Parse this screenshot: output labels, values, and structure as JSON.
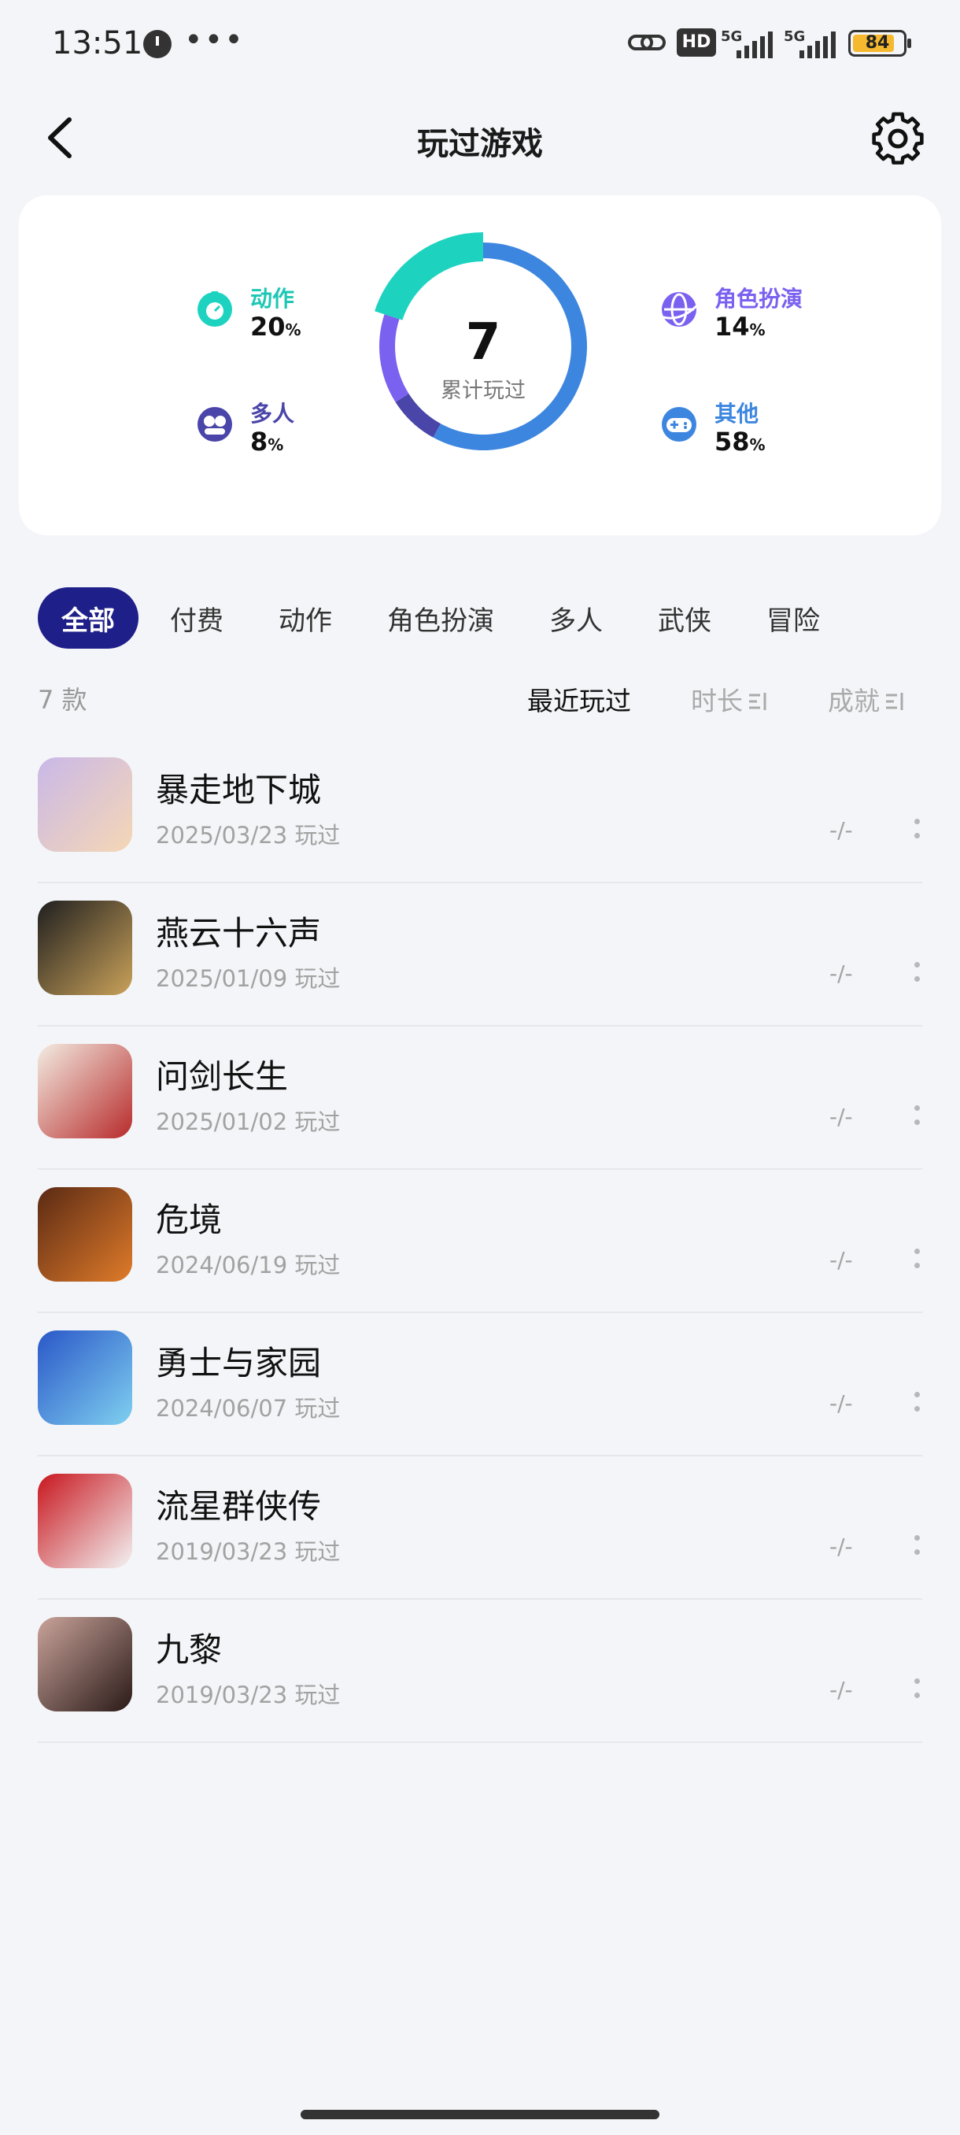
{
  "status_bar": {
    "time": "13:51",
    "dots": "•••",
    "hd_label": "HD",
    "network_1": "5G",
    "network_2": "5G",
    "battery": "84",
    "battery_level_percent": 84
  },
  "header": {
    "title": "玩过游戏",
    "back_icon": "chevron-left-icon",
    "settings_icon": "gear-icon"
  },
  "summary": {
    "total_count": "7",
    "total_caption": "累计玩过",
    "categories": [
      {
        "name": "动作",
        "percent": "20",
        "value": 20,
        "color": "#1dd3c0",
        "icon": "action-icon"
      },
      {
        "name": "多人",
        "percent": "8",
        "value": 8,
        "color": "#4a45a8",
        "icon": "multiplayer-icon"
      },
      {
        "name": "角色扮演",
        "percent": "14",
        "value": 14,
        "color": "#7b61f0",
        "icon": "globe-icon"
      },
      {
        "name": "其他",
        "percent": "58",
        "value": 58,
        "color": "#3d86e0",
        "icon": "gamepad-icon"
      }
    ],
    "percent_sign": "%"
  },
  "filter_tabs": [
    "全部",
    "付费",
    "动作",
    "角色扮演",
    "多人",
    "武侠",
    "冒险"
  ],
  "active_tab_index": 0,
  "list_meta": {
    "count_label": "7 款",
    "sort_recent": "最近玩过",
    "sort_duration": "时长",
    "sort_achievement": "成就"
  },
  "games": [
    {
      "name": "暴走地下城",
      "date": "2025/03/23 玩过",
      "achievement": "-/-",
      "icon_colors": [
        "#c9b8e8",
        "#f5d7b5"
      ]
    },
    {
      "name": "燕云十六声",
      "date": "2025/01/09 玩过",
      "achievement": "-/-",
      "icon_colors": [
        "#1f1f1f",
        "#caa25a"
      ]
    },
    {
      "name": "问剑长生",
      "date": "2025/01/02 玩过",
      "achievement": "-/-",
      "icon_colors": [
        "#f3ece2",
        "#b72b2b"
      ]
    },
    {
      "name": "危境",
      "date": "2024/06/19 玩过",
      "achievement": "-/-",
      "icon_colors": [
        "#5a2a14",
        "#e07b2a"
      ]
    },
    {
      "name": "勇士与家园",
      "date": "2024/06/07 玩过",
      "achievement": "-/-",
      "icon_colors": [
        "#2a57c8",
        "#7fd0f0"
      ]
    },
    {
      "name": "流星群侠传",
      "date": "2019/03/23 玩过",
      "achievement": "-/-",
      "icon_colors": [
        "#c8161e",
        "#f3f3f3"
      ]
    },
    {
      "name": "九黎",
      "date": "2019/03/23 玩过",
      "achievement": "-/-",
      "icon_colors": [
        "#c9a39a",
        "#2a1a18"
      ]
    }
  ]
}
